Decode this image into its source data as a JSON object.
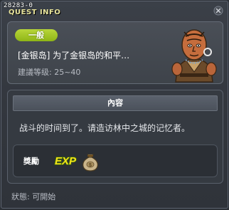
{
  "window": {
    "quest_id": "28283-0",
    "title": "QUEST INFO"
  },
  "header": {
    "type_badge": "一般",
    "quest_name": "[金银岛] 为了金银岛的和平…",
    "level_label": "建議等级: 25~40"
  },
  "content": {
    "header_label": "內容",
    "description": "战斗的时间到了。请造访林中之城的记忆者。",
    "reward_label": "獎勵",
    "reward_items": [
      "exp-icon",
      "money-bag-icon"
    ]
  },
  "footer": {
    "status": "狀態: 可開始"
  },
  "colors": {
    "badge_green": "#9dc323",
    "title_yellow": "#e7e39a",
    "panel_bg": "#3e434a"
  }
}
